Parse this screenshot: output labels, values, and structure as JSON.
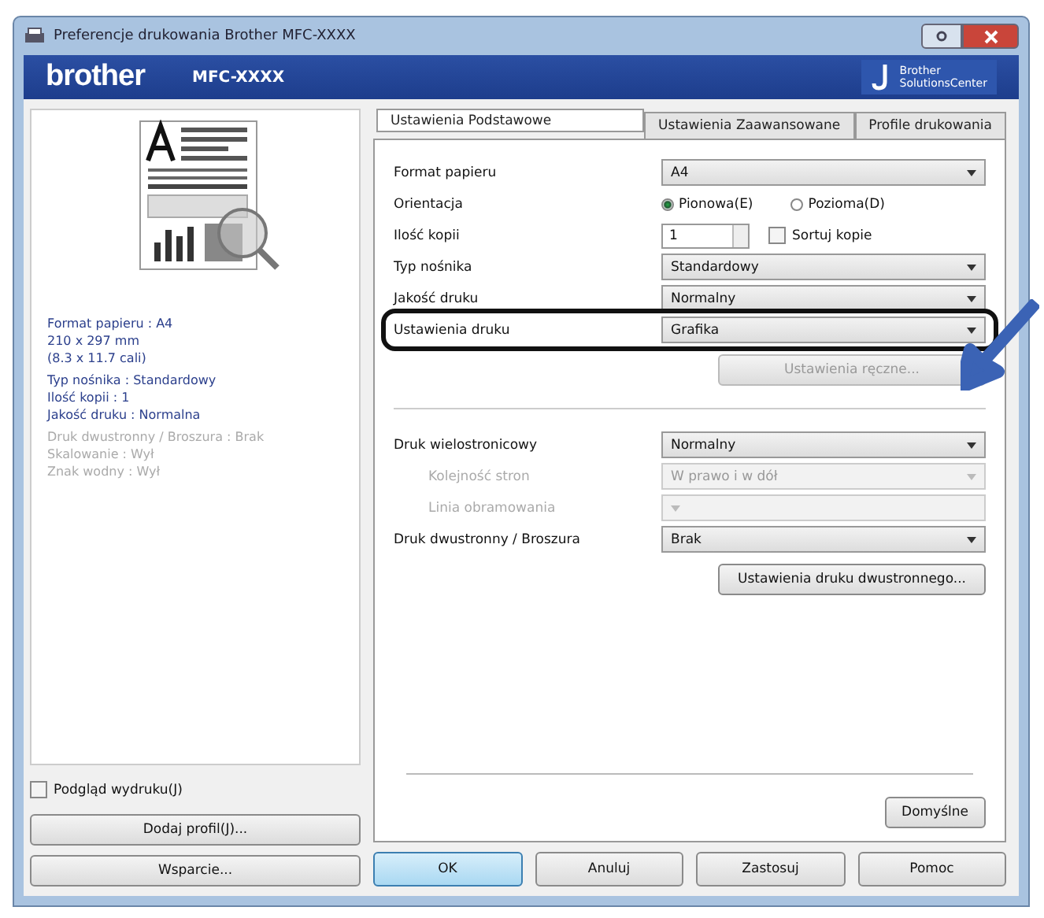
{
  "window": {
    "title": "Preferencje drukowania Brother MFC-XXXX"
  },
  "header": {
    "brand": "brother",
    "model": "MFC-XXXX",
    "solutions": [
      "Brother",
      "SolutionsCenter"
    ]
  },
  "summary": [
    {
      "text": "Format papieru : A4",
      "disabled": false
    },
    {
      "text": "210 x 297 mm",
      "disabled": false
    },
    {
      "text": "(8.3 x 11.7 cali)",
      "disabled": false
    },
    {
      "text": "Typ nośnika : Standardowy",
      "disabled": false
    },
    {
      "text": "Ilość kopii : 1",
      "disabled": false
    },
    {
      "text": "Jakość druku : Normalna",
      "disabled": false
    },
    {
      "text": "Druk dwustronny / Broszura : Brak",
      "disabled": true
    },
    {
      "text": "Skalowanie : Wył",
      "disabled": true
    },
    {
      "text": "Znak wodny : Wył",
      "disabled": true
    }
  ],
  "preview_checkbox": {
    "label": "Podgląd wydruku(J)",
    "checked": false
  },
  "left_buttons": [
    "Dodaj profil(J)...",
    "Wsparcie..."
  ],
  "tabs": [
    {
      "label": "Ustawienia Podstawowe",
      "selected": true
    },
    {
      "label": "Ustawienia Zaawansowane",
      "selected": false
    },
    {
      "label": "Profile drukowania",
      "selected": false
    }
  ],
  "settings_top": [
    {
      "kind": "select",
      "label": "Format papieru",
      "value": "A4",
      "disabled": false
    },
    {
      "kind": "radio",
      "label": "Orientacja",
      "options": [
        {
          "label": "Pionowa(E)",
          "selected": true
        },
        {
          "label": "Pozioma(D)",
          "selected": false
        }
      ]
    },
    {
      "kind": "copies",
      "label": "Ilość kopii",
      "value": "1",
      "checkbox": {
        "label": "Sortuj kopie",
        "checked": false
      }
    },
    {
      "kind": "select",
      "label": "Typ nośnika",
      "value": "Standardowy",
      "disabled": false
    },
    {
      "kind": "select",
      "label": "Jakość druku",
      "value": "Normalny",
      "disabled": false
    },
    {
      "kind": "select",
      "label": "Ustawienia druku",
      "value": "Grafika",
      "disabled": false,
      "highlighted": true
    }
  ],
  "manual_button": {
    "label": "Ustawienia ręczne...",
    "disabled": true
  },
  "settings_bottom": [
    {
      "kind": "select",
      "label": "Druk wielostronicowy",
      "value": "Normalny",
      "disabled": false
    },
    {
      "kind": "select",
      "label": "Kolejność stron",
      "value": "W prawo i w dół",
      "disabled": true
    },
    {
      "kind": "select",
      "label": "Linia obramowania",
      "disabled": true
    },
    {
      "kind": "select",
      "label": "Druk dwustronny / Broszura",
      "value": "Brak",
      "disabled": false
    }
  ],
  "duplex_button": {
    "label": "Ustawienia druku dwustronnego...",
    "disabled": false
  },
  "default_button": "Domyślne",
  "dialog_buttons": [
    {
      "label": "OK",
      "default": true
    },
    {
      "label": "Anuluj",
      "default": false
    },
    {
      "label": "Zastosuj",
      "default": false
    },
    {
      "label": "Pomoc",
      "default": false
    }
  ]
}
